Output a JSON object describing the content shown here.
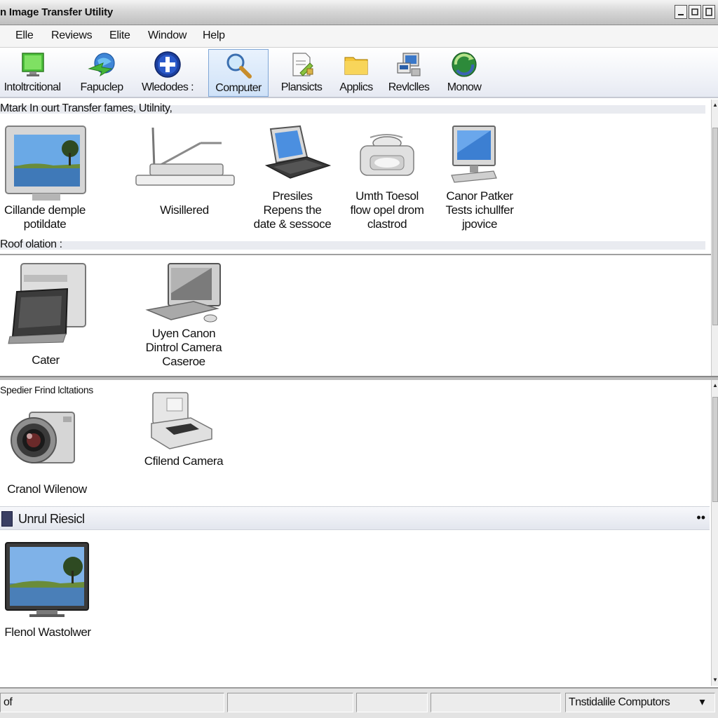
{
  "window": {
    "title": "n Image Transfer Utility"
  },
  "menu": [
    "Elle",
    "Reviews",
    "Elite",
    "Window",
    "Help"
  ],
  "toolbar": [
    {
      "label": "Intoltrcitional",
      "icon": "monitor-green-icon"
    },
    {
      "label": "Fapuclep",
      "icon": "globe-arrow-icon"
    },
    {
      "label": "Wledodes :",
      "icon": "plus-circle-icon"
    },
    {
      "label": "Computer",
      "icon": "magnifier-icon",
      "active": true
    },
    {
      "label": "Plansicts",
      "icon": "document-pencil-icon"
    },
    {
      "label": "Applics",
      "icon": "folder-icon"
    },
    {
      "label": "Revlclles",
      "icon": "devices-icon"
    },
    {
      "label": "Monow",
      "icon": "recycle-arrows-icon"
    }
  ],
  "sections": {
    "one": {
      "header": "Mtark In ourt Transfer fames, Utilnity,",
      "items": [
        {
          "caption": "Cillande demple\npotildate",
          "icon": "monitor-landscape-icon"
        },
        {
          "caption": "Wisillered",
          "icon": "scanner-icon"
        },
        {
          "caption": "Presiles\nRepens the\ndate & sessoce",
          "icon": "laptop-icon"
        },
        {
          "caption": "Umth Toesol\nflow opel drom\nclastrod",
          "icon": "printer-icon"
        },
        {
          "caption": "Canor Patker\nTests ichullfer\njpovice",
          "icon": "desktop-monitor-icon"
        }
      ]
    },
    "two": {
      "header": "Roof olation :",
      "items": [
        {
          "caption": "Cater",
          "icon": "card-printer-icon"
        },
        {
          "caption": "Uyen Canon\nDintrol Camera\nCaseroe",
          "icon": "computer-terminal-icon"
        }
      ]
    },
    "three": {
      "header": "Spedier Frind lcltations",
      "items": [
        {
          "caption": "Cranol Wilenow",
          "icon": "camera-icon"
        },
        {
          "caption": "Cfilend Camera",
          "icon": "photo-printer-icon"
        }
      ]
    },
    "four": {
      "header": "Unrul Riesicl",
      "more": "••",
      "items": [
        {
          "caption": "Flenol Wastolwer",
          "icon": "monitor-landscape-icon"
        }
      ]
    }
  },
  "status": {
    "left": "of",
    "right": "Tnstidalile Computors",
    "dropdown_glyph": "▾"
  }
}
